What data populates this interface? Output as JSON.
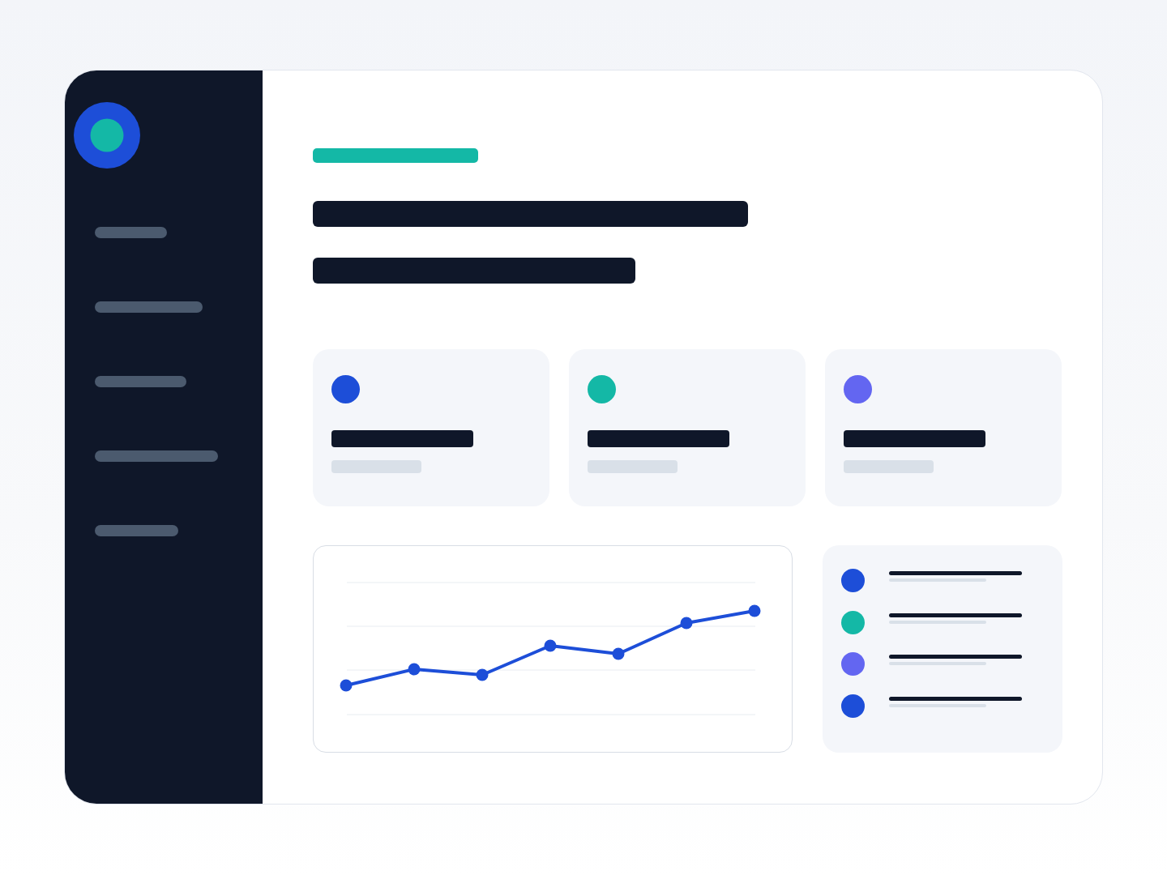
{
  "stat_cards": [
    {
      "color": "#1d4ed8"
    },
    {
      "color": "#14b8a6"
    },
    {
      "color": "#6366f1"
    }
  ],
  "legend_items": [
    {
      "color": "#1d4ed8"
    },
    {
      "color": "#14b8a6"
    },
    {
      "color": "#6366f1"
    },
    {
      "color": "#1d4ed8"
    }
  ]
}
